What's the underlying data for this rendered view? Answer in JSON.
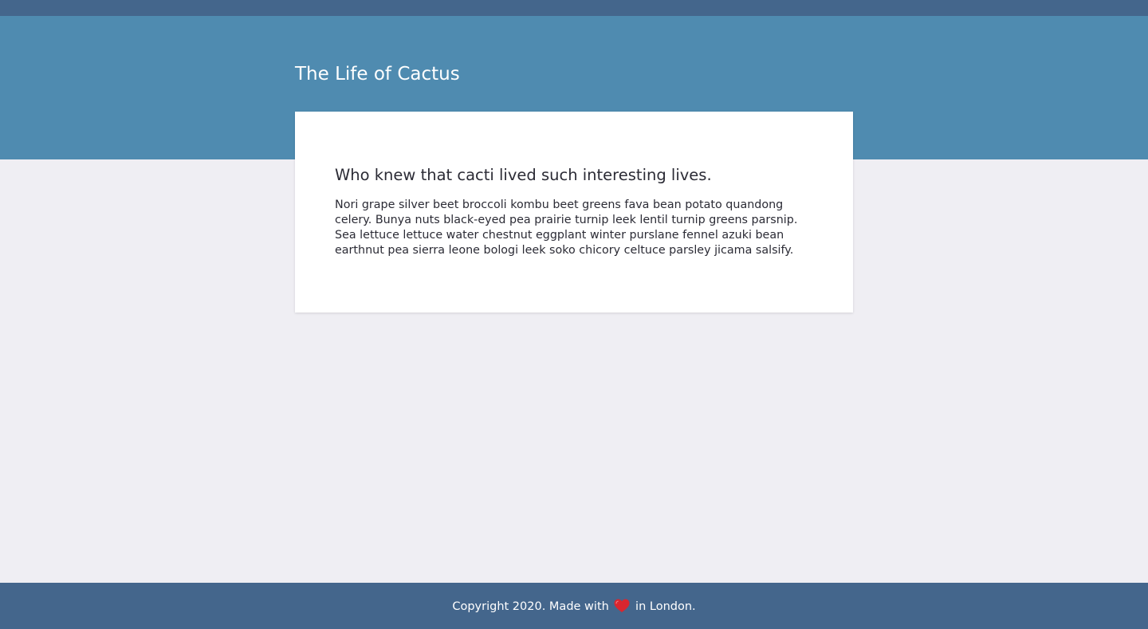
{
  "header": {
    "title": "The Life of Cactus"
  },
  "article": {
    "heading": "Who knew that cacti lived such interesting lives.",
    "body_lines": [
      "Nori grape silver beet broccoli kombu beet greens fava bean potato quandong",
      "celery. Bunya nuts black-eyed pea prairie turnip leek lentil turnip greens parsnip.",
      "Sea lettuce lettuce water chestnut eggplant winter purslane fennel azuki bean",
      "earthnut pea sierra leone bologi leek soko chicory celtuce parsley jicama salsify."
    ]
  },
  "footer": {
    "text_before": "Copyright 2020. Made with",
    "icon": "heart-icon",
    "text_after": "in London."
  },
  "colors": {
    "top_strip": "#44668c",
    "hero": "#4f8bb0",
    "page_background": "#efeef3",
    "card": "#ffffff",
    "footer": "#44668c",
    "heart": "#d9262f"
  }
}
